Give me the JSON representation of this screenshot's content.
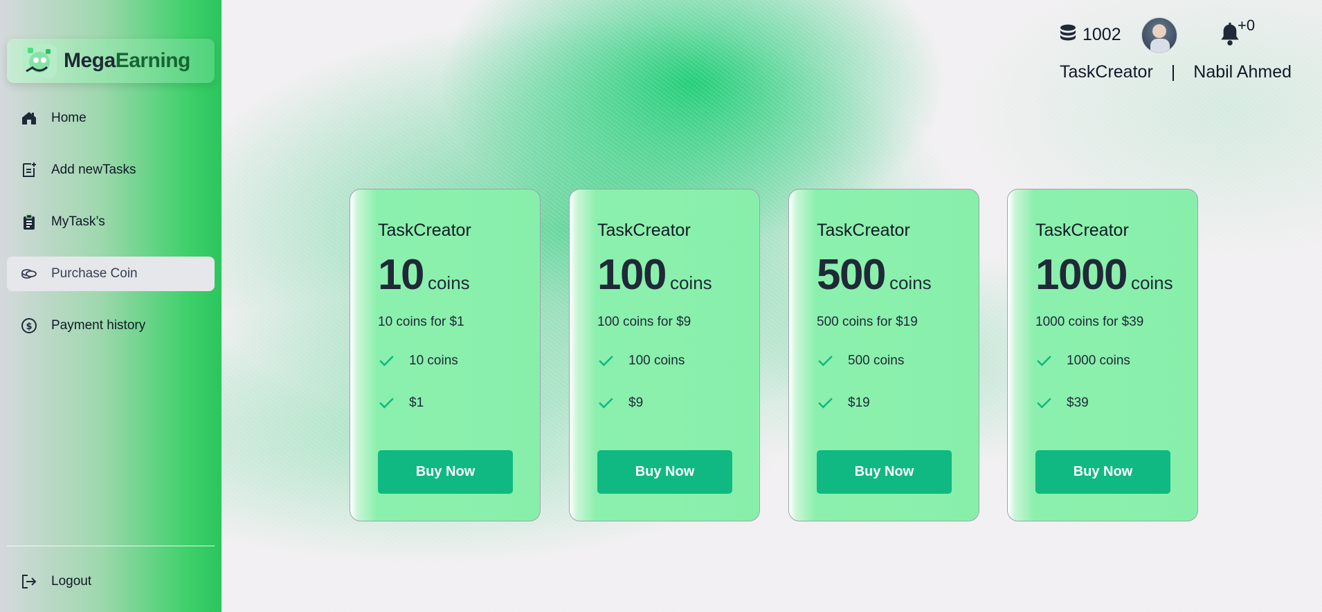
{
  "brand": {
    "name_part1": "Mega",
    "name_part2": "Earning"
  },
  "sidebar": {
    "items": [
      {
        "label": "Home",
        "icon": "home-icon"
      },
      {
        "label": "Add newTasks",
        "icon": "add-task-icon"
      },
      {
        "label": "MyTask’s",
        "icon": "clipboard-icon"
      },
      {
        "label": "Purchase Coin",
        "icon": "coins-icon",
        "active": true
      },
      {
        "label": "Payment history",
        "icon": "dollar-circle-icon"
      }
    ],
    "logout_label": "Logout"
  },
  "header": {
    "coin_balance": "1002",
    "notification_count": "+0",
    "role": "TaskCreator",
    "separator": "|",
    "user_name": "Nabil Ahmed"
  },
  "packages": [
    {
      "title": "TaskCreator",
      "amount": "10",
      "unit": "coins",
      "description": "10 coins for $1",
      "features": [
        "10 coins",
        "$1"
      ],
      "button_label": "Buy Now"
    },
    {
      "title": "TaskCreator",
      "amount": "100",
      "unit": "coins",
      "description": "100 coins for $9",
      "features": [
        "100 coins",
        "$9"
      ],
      "button_label": "Buy Now"
    },
    {
      "title": "TaskCreator",
      "amount": "500",
      "unit": "coins",
      "description": "500 coins for $19",
      "features": [
        "500 coins",
        "$19"
      ],
      "button_label": "Buy Now"
    },
    {
      "title": "TaskCreator",
      "amount": "1000",
      "unit": "coins",
      "description": "1000 coins for $39",
      "features": [
        "1000 coins",
        "$39"
      ],
      "button_label": "Buy Now"
    }
  ],
  "colors": {
    "accent": "#10b981",
    "sidebar_green": "#2cc55d",
    "card_green": "#88efab",
    "check": "#10b981"
  }
}
